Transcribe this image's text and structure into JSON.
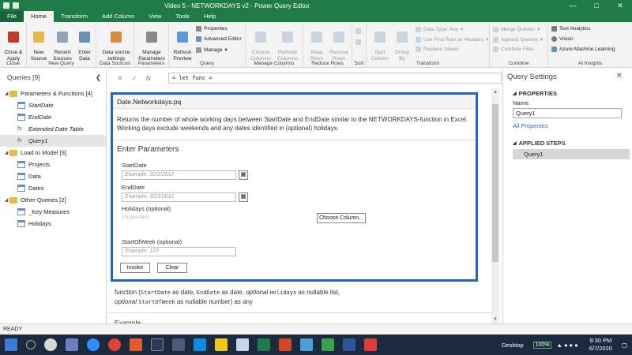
{
  "window": {
    "title": "Video 5 - NETWORKDAYS v2 - Power Query Editor"
  },
  "tabs": [
    "File",
    "Home",
    "Transform",
    "Add Column",
    "View",
    "Tools",
    "Help"
  ],
  "ribbon": {
    "close_apply": "Close &\nApply",
    "new_source": "New\nSource",
    "recent_sources": "Recent\nSources",
    "enter_data": "Enter\nData",
    "ds_settings": "Data source\nsettings",
    "manage_params": "Manage\nParameters",
    "refresh_preview": "Refresh\nPreview",
    "properties": "Properties",
    "advanced_editor": "Advanced Editor",
    "manage": "Manage",
    "choose_columns": "Choose\nColumns",
    "remove_columns": "Remove\nColumns",
    "keep_rows": "Keep\nRows",
    "remove_rows": "Remove\nRows",
    "split_column": "Split\nColumn",
    "group_by": "Group\nBy",
    "data_type": "Data Type: Any",
    "first_row_headers": "Use First Row as Headers",
    "replace_values": "Replace Values",
    "merge_queries": "Merge Queries",
    "append_queries": "Append Queries",
    "combine_files": "Combine Files",
    "text_analytics": "Text Analytics",
    "vision": "Vision",
    "azure_ml": "Azure Machine Learning",
    "groups": {
      "close": "Close",
      "new_query": "New Query",
      "data_sources": "Data Sources",
      "parameters": "Parameters",
      "query": "Query",
      "manage_columns": "Manage Columns",
      "reduce_rows": "Reduce Rows",
      "sort": "Sort",
      "transform": "Transform",
      "combine": "Combine",
      "ai_insights": "AI Insights"
    }
  },
  "formula": {
    "text": "= let func ="
  },
  "queries": {
    "header": "Queries [9]",
    "items": [
      {
        "label": "Parameters & Functions [4]",
        "type": "folder",
        "level": 0
      },
      {
        "label": "StartDate",
        "type": "table",
        "level": 1
      },
      {
        "label": "EndDate",
        "type": "table",
        "level": 1
      },
      {
        "label": "Extended Date Table",
        "type": "fx",
        "level": 1
      },
      {
        "label": "Query1",
        "type": "fx",
        "level": 1
      },
      {
        "label": "Load to Model [3]",
        "type": "folder",
        "level": 0
      },
      {
        "label": "Projects",
        "type": "table",
        "level": 1
      },
      {
        "label": "Data",
        "type": "table",
        "level": 1
      },
      {
        "label": "Dates",
        "type": "table",
        "level": 1
      },
      {
        "label": "Other Queries [2]",
        "type": "folder",
        "level": 0
      },
      {
        "label": "_Key Measures",
        "type": "table",
        "level": 1
      },
      {
        "label": "Holidays",
        "type": "table",
        "level": 1
      }
    ]
  },
  "function": {
    "name": "Date.Networkdays.pq",
    "description": "Returns the number of whole working days between StartDate and EndDate similar to the NETWORKDAYS-function in Excel. Working days exclude weekends and any dates identified in (optional) holidays.",
    "enter_params": "Enter Parameters",
    "startdate_label": "StartDate",
    "startdate_placeholder": "Example: 3/21/2012",
    "enddate_label": "EndDate",
    "enddate_placeholder": "Example: 3/21/2012",
    "holidays_label": "Holidays (optional)",
    "holidays_value": "Unspecified",
    "choose_column": "Choose Column...",
    "startofweek_label": "StartOfWeek (optional)",
    "startofweek_placeholder": "Example: 123",
    "invoke": "Invoke",
    "clear": "Clear",
    "sig": {
      "p1": "function (",
      "a1": "StartDate",
      "p2": " as date, ",
      "a2": "EndDate",
      "p3": " as date, ",
      "opt1": "optional",
      "a3": "Holidays",
      "p4": " as nullable list,",
      "opt2": "optional",
      "a4": "StartOfWeek",
      "p5": " as nullable number) as any"
    },
    "example": "Example"
  },
  "settings": {
    "title": "Query Settings",
    "properties": "PROPERTIES",
    "name_label": "Name",
    "name_value": "Query1",
    "all_properties": "All Properties",
    "applied_steps": "APPLIED STEPS",
    "steps": [
      "Query1"
    ]
  },
  "status": {
    "text": "READY"
  },
  "taskbar": {
    "desktop": "Desktop",
    "battery": "100%",
    "time": "9:30 PM",
    "date": "6/7/2020"
  }
}
